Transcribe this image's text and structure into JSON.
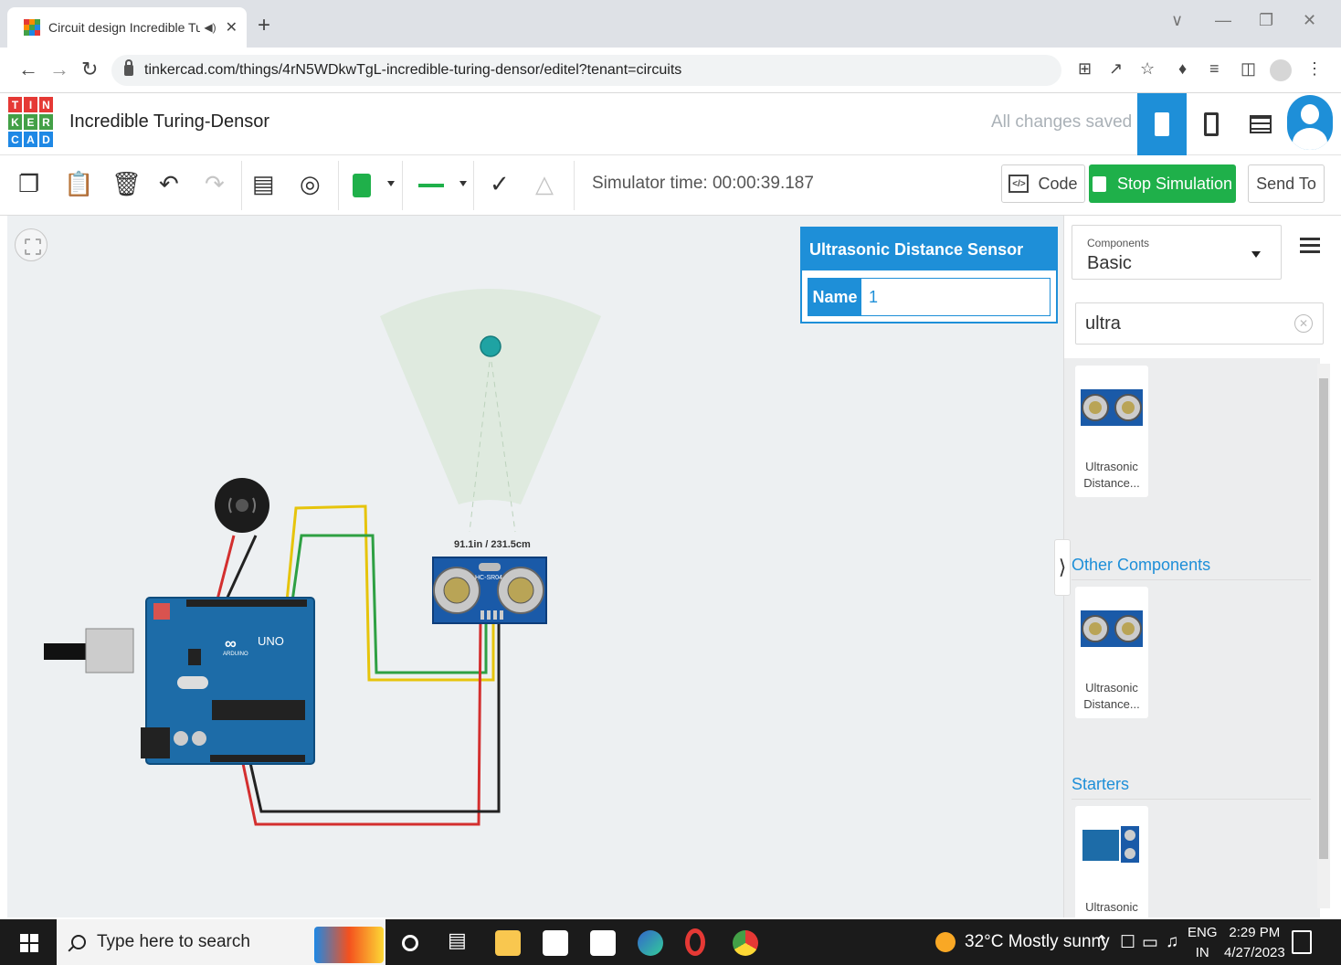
{
  "browser": {
    "tab_title": "Circuit design Incredible Turi",
    "url": "tinkercad.com/things/4rN5WDkwTgL-incredible-turing-densor/editel?tenant=circuits"
  },
  "app": {
    "logo": [
      "T",
      "I",
      "N",
      "K",
      "E",
      "R",
      "C",
      "A",
      "D"
    ],
    "project_title": "Incredible Turing-Densor",
    "save_status": "All changes saved",
    "accent_color": "#1e8fd8"
  },
  "toolbar": {
    "simulator_time": "Simulator time: 00:00:39.187",
    "code_label": "Code",
    "stop_label": "Stop Simulation",
    "send_label": "Send To",
    "wire_color": "#1fb04a"
  },
  "canvas": {
    "distance_label": "91.1in / 231.5cm",
    "sensor_chip_label": "HC-SR04",
    "board_label": "UNO",
    "board_brand": "ARDUINO"
  },
  "inspector": {
    "title": "Ultrasonic Distance Sensor",
    "name_label": "Name",
    "name_value": "1"
  },
  "components": {
    "caption": "Components",
    "selected": "Basic",
    "search_value": "ultra",
    "results": [
      {
        "label_line1": "Ultrasonic",
        "label_line2": "Distance..."
      }
    ],
    "sections": [
      {
        "title": "Other Components",
        "items": [
          {
            "label_line1": "Ultrasonic",
            "label_line2": "Distance..."
          }
        ]
      },
      {
        "title": "Starters",
        "items": [
          {
            "label_line1": "Ultrasonic",
            "label_line2": ""
          }
        ]
      }
    ]
  },
  "taskbar": {
    "search_placeholder": "Type here to search",
    "weather": "32°C  Mostly sunny",
    "lang_top": "ENG",
    "lang_bottom": "IN",
    "time": "2:29 PM",
    "date": "4/27/2023"
  }
}
